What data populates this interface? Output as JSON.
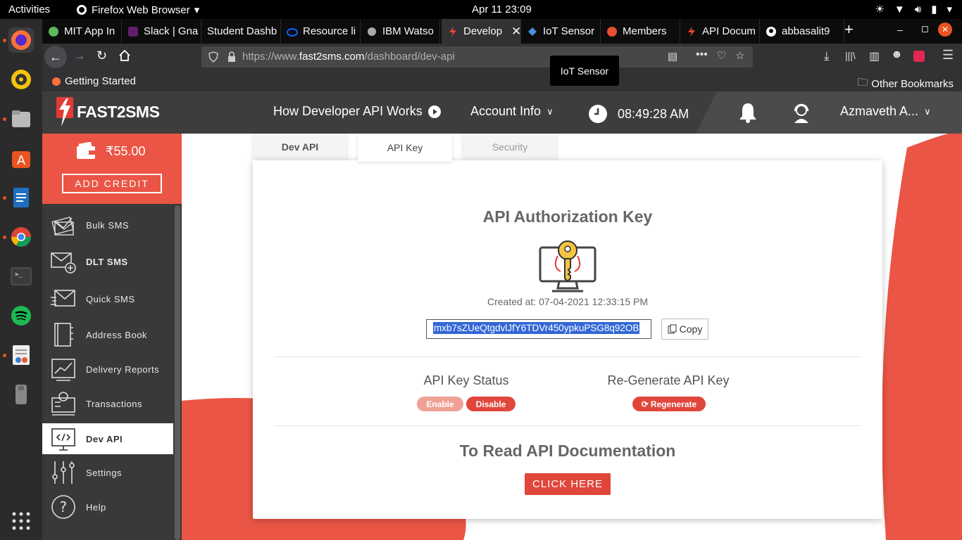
{
  "system": {
    "activities": "Activities",
    "app_name": "Firefox Web Browser",
    "clock": "Apr 11  23:09"
  },
  "tabs": [
    {
      "label": "MIT App In",
      "color": "#5cb85c"
    },
    {
      "label": "Slack | Gna",
      "color": "#611f69"
    },
    {
      "label": "Student Dashb",
      "color": "#555555"
    },
    {
      "label": "Resource li",
      "color": "#0f62fe"
    },
    {
      "label": "IBM Watso",
      "color": "#aaaaaa"
    },
    {
      "label": "Develop",
      "color": "#ea4335"
    },
    {
      "label": "IoT Sensor",
      "color": "#4a90e2"
    },
    {
      "label": "Members",
      "color": "#e8502f"
    },
    {
      "label": "API Docum",
      "color": "#ea4335"
    },
    {
      "label": "abbasalit9",
      "color": "#ffffff"
    }
  ],
  "browser": {
    "url_prefix": "https://www.",
    "url_domain": "fast2sms.com",
    "url_path": "/dashboard/dev-api",
    "bookmark_getting_started": "Getting Started",
    "bookmark_other": "Other Bookmarks",
    "tooltip": "IoT Sensor"
  },
  "header": {
    "logo": "FAST2SMS",
    "how_it_works": "How Developer API Works",
    "account_info": "Account Info",
    "time": "08:49:28 AM",
    "user": "Azmaveth A..."
  },
  "wallet": {
    "balance": "₹55.00",
    "add_credit": "ADD CREDIT"
  },
  "sidebar": {
    "items": [
      {
        "label": "Bulk SMS",
        "icon": "bulk-sms-icon"
      },
      {
        "label": "DLT SMS",
        "icon": "dlt-sms-icon"
      },
      {
        "label": "Quick SMS",
        "icon": "quick-sms-icon"
      },
      {
        "label": "Address Book",
        "icon": "address-book-icon"
      },
      {
        "label": "Delivery Reports",
        "icon": "delivery-reports-icon"
      },
      {
        "label": "Transactions",
        "icon": "transactions-icon"
      },
      {
        "label": "Dev API",
        "icon": "dev-api-icon"
      },
      {
        "label": "Settings",
        "icon": "settings-icon"
      },
      {
        "label": "Help",
        "icon": "help-icon"
      }
    ]
  },
  "content": {
    "tabs": [
      "Dev API",
      "API Key",
      "Security"
    ],
    "title": "API Authorization Key",
    "created_at": "Created at: 07-04-2021 12:33:15 PM",
    "api_key": "mxb7sZUeQtgdvlJfY6TDVr450ypkuPSG8q92OB",
    "copy": "Copy",
    "status_title": "API Key Status",
    "enable": "Enable",
    "disable": "Disable",
    "regen_title": "Re-Generate API Key",
    "regenerate": "Regenerate",
    "docs_title": "To Read API Documentation",
    "click_here": "CLICK HERE"
  },
  "colors": {
    "brand": "#ea5545",
    "header": "#3d3d3d",
    "sidebar": "#393939"
  }
}
